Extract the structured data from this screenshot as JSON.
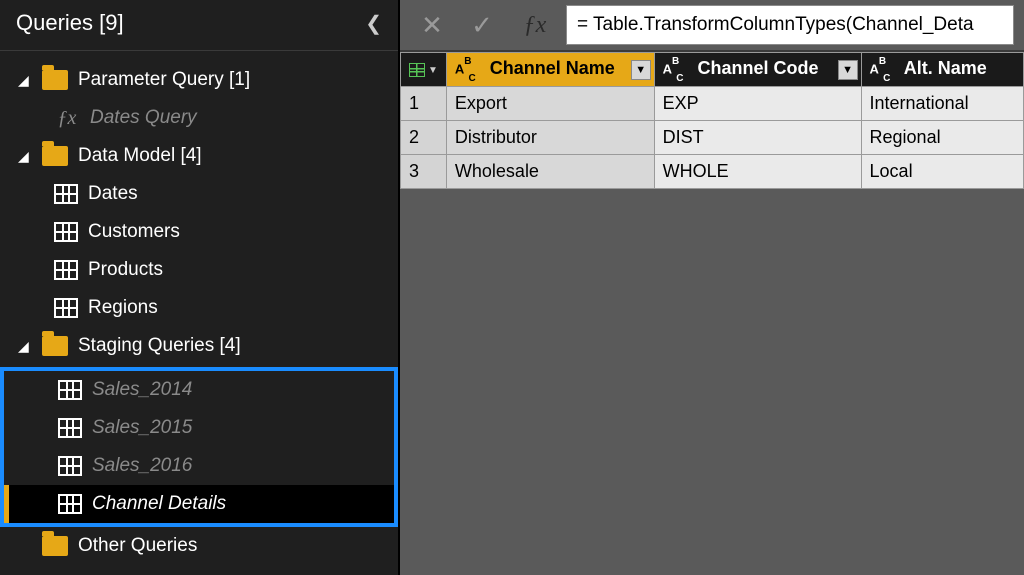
{
  "sidebar": {
    "title": "Queries [9]",
    "groups": [
      {
        "label": "Parameter Query [1]",
        "children": [
          {
            "label": "Dates Query",
            "icon": "fx",
            "dim": true
          }
        ]
      },
      {
        "label": "Data Model [4]",
        "children": [
          {
            "label": "Dates",
            "icon": "table"
          },
          {
            "label": "Customers",
            "icon": "table"
          },
          {
            "label": "Products",
            "icon": "table"
          },
          {
            "label": "Regions",
            "icon": "table"
          }
        ]
      },
      {
        "label": "Staging Queries [4]",
        "highlighted": true,
        "children": [
          {
            "label": "Sales_2014",
            "icon": "table",
            "dim": true,
            "italic": true
          },
          {
            "label": "Sales_2015",
            "icon": "table",
            "dim": true,
            "italic": true
          },
          {
            "label": "Sales_2016",
            "icon": "table",
            "dim": true,
            "italic": true
          },
          {
            "label": "Channel Details",
            "icon": "table",
            "italic": true,
            "selected": true
          }
        ]
      },
      {
        "label": "Other Queries",
        "children": []
      }
    ]
  },
  "formula_bar": {
    "value": "= Table.TransformColumnTypes(Channel_Deta"
  },
  "table": {
    "columns": [
      {
        "name": "Channel Name",
        "type": "ABC",
        "selected": true
      },
      {
        "name": "Channel Code",
        "type": "ABC"
      },
      {
        "name": "Alt. Name",
        "type": "ABC"
      }
    ],
    "rows": [
      {
        "n": "1",
        "cells": [
          "Export",
          "EXP",
          "International"
        ]
      },
      {
        "n": "2",
        "cells": [
          "Distributor",
          "DIST",
          "Regional"
        ]
      },
      {
        "n": "3",
        "cells": [
          "Wholesale",
          "WHOLE",
          "Local"
        ]
      }
    ]
  }
}
